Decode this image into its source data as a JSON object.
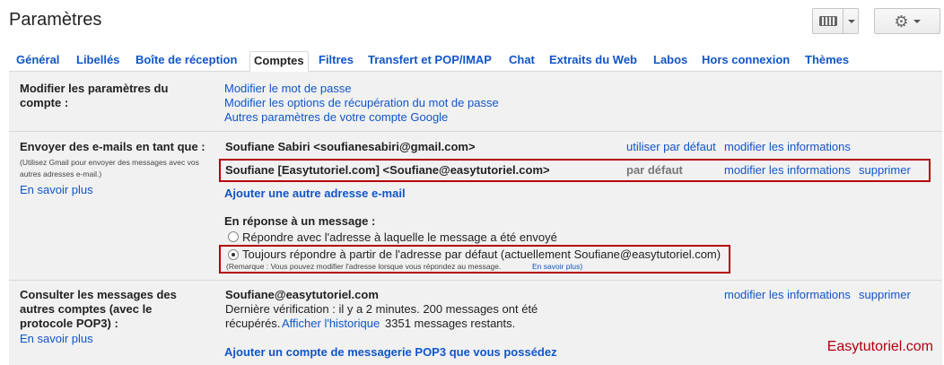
{
  "header": {
    "title": "Paramètres"
  },
  "tabs": [
    {
      "label": "Général"
    },
    {
      "label": "Libellés"
    },
    {
      "label": "Boîte de réception"
    },
    {
      "label": "Comptes"
    },
    {
      "label": "Filtres"
    },
    {
      "label": "Transfert et POP/IMAP"
    },
    {
      "label": "Chat"
    },
    {
      "label": "Extraits du Web"
    },
    {
      "label": "Labos"
    },
    {
      "label": "Hors connexion"
    },
    {
      "label": "Thèmes"
    }
  ],
  "account": {
    "label": "Modifier les paramètres du compte :",
    "links": [
      "Modifier le mot de passe",
      "Modifier les options de récupération du mot de passe",
      "Autres paramètres de votre compte Google"
    ]
  },
  "send_as": {
    "label": "Envoyer des e-mails en tant que :",
    "note": "(Utilisez Gmail pour envoyer des messages avec vos autres adresses e-mail.)",
    "learn_more": "En savoir plus",
    "rows": [
      {
        "address": "Soufiane Sabiri <soufianesabiri@gmail.com>",
        "status": "utiliser par défaut",
        "edit": "modifier les informations"
      },
      {
        "address": "Soufiane [Easytutoriel.com] <Soufiane@easytutoriel.com>",
        "status": "par défaut",
        "edit": "modifier les informations",
        "delete": "supprimer"
      }
    ],
    "add_link": "Ajouter une autre adresse e-mail",
    "reply_label": "En réponse à un message :",
    "reply_opt1": "Répondre avec l'adresse à laquelle le message a été envoyé",
    "reply_opt2": "Toujours répondre à partir de l'adresse par défaut (actuellement Soufiane@easytutoriel.com)",
    "reply_note": "(Remarque : Vous pouvez modifier l'adresse lorsque vous répondez au message.",
    "reply_note_link": "En savoir plus)"
  },
  "pop3": {
    "label": "Consulter les messages des autres comptes (avec le protocole POP3) :",
    "learn_more": "En savoir plus",
    "account": "Soufiane@easytutoriel.com",
    "check_line1": "Dernière vérification : il y a 2 minutes. 200 messages ont été",
    "check_line2a": "récupérés.",
    "history_link": "Afficher l'historique",
    "check_line2b": "3351 messages restants.",
    "edit": "modifier les informations",
    "delete": "supprimer",
    "add_link": "Ajouter un compte de messagerie POP3 que vous possédez"
  },
  "watermark": "Easytutoriel.com",
  "colors": {
    "link": "#1155cc",
    "highlight": "#b3000c",
    "panel": "#f1f1f1"
  }
}
